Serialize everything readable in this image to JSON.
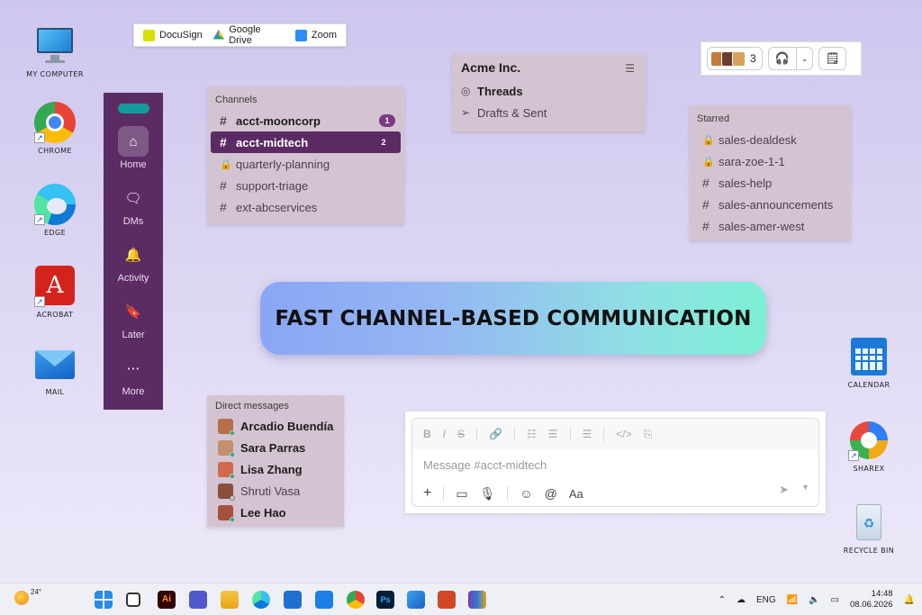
{
  "desktop": {
    "icons_left": [
      {
        "label": "MY COMPUTER",
        "icon": "monitor-icon"
      },
      {
        "label": "CHROME",
        "icon": "chrome-icon"
      },
      {
        "label": "EDGE",
        "icon": "edge-icon"
      },
      {
        "label": "ACROBAT",
        "icon": "acrobat-icon"
      },
      {
        "label": "MAIL",
        "icon": "mail-icon"
      }
    ],
    "icons_right": [
      {
        "label": "CALENDAR",
        "icon": "calendar-icon"
      },
      {
        "label": "SHAREX",
        "icon": "sharex-icon"
      },
      {
        "label": "RECYCLE BIN",
        "icon": "recycle-bin-icon"
      }
    ]
  },
  "bookmarks": [
    {
      "label": "DocuSign",
      "color": "#d9e000"
    },
    {
      "label": "Google Drive",
      "color": "#1fa463"
    },
    {
      "label": "Zoom",
      "color": "#2d8cff"
    }
  ],
  "rail": {
    "items": [
      {
        "label": "Home",
        "icon": "home-icon"
      },
      {
        "label": "DMs",
        "icon": "dms-icon"
      },
      {
        "label": "Activity",
        "icon": "bell-icon"
      },
      {
        "label": "Later",
        "icon": "bookmark-icon"
      },
      {
        "label": "More",
        "icon": "more-icon"
      }
    ]
  },
  "workspace": {
    "name": "Acme Inc.",
    "threads": "Threads",
    "drafts": "Drafts & Sent"
  },
  "channels": {
    "header": "Channels",
    "items": [
      {
        "name": "acct-mooncorp",
        "badge": "1"
      },
      {
        "name": "acct-midtech",
        "badge": "2"
      },
      {
        "name": "quarterly-planning"
      },
      {
        "name": "support-triage"
      },
      {
        "name": "ext-abcservices"
      }
    ]
  },
  "starred": {
    "header": "Starred",
    "items": [
      "sales-dealdesk",
      "sara-zoe-1-1",
      "sales-help",
      "sales-announcements",
      "sales-amer-west"
    ]
  },
  "huddle": {
    "count": "3"
  },
  "banner": {
    "text": "FAST CHANNEL-BASED COMMUNICATION"
  },
  "dms": {
    "header": "Direct messages",
    "items": [
      {
        "name": "Arcadio Buendía",
        "color": "#b76e4a"
      },
      {
        "name": "Sara Parras",
        "color": "#c58e6e"
      },
      {
        "name": "Lisa Zhang",
        "color": "#d16a4a"
      },
      {
        "name": "Shruti Vasa",
        "color": "#8a4f3a"
      },
      {
        "name": "Lee Hao",
        "color": "#a6503e"
      }
    ]
  },
  "composer": {
    "placeholder": "Message #acct-midtech"
  },
  "taskbar": {
    "weather": "24°",
    "language": "ENG",
    "time": "14:48",
    "date": "08.06.2026"
  }
}
